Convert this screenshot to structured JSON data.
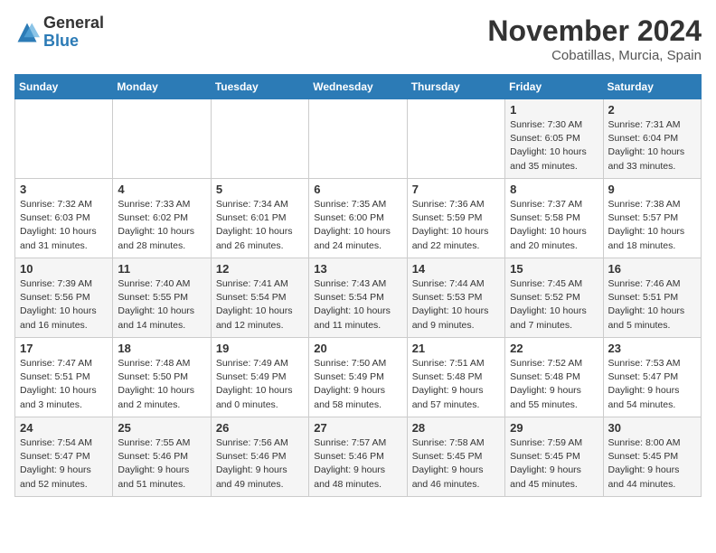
{
  "header": {
    "logo_line1": "General",
    "logo_line2": "Blue",
    "month_year": "November 2024",
    "location": "Cobatillas, Murcia, Spain"
  },
  "days_of_week": [
    "Sunday",
    "Monday",
    "Tuesday",
    "Wednesday",
    "Thursday",
    "Friday",
    "Saturday"
  ],
  "weeks": [
    [
      {
        "day": "",
        "info": ""
      },
      {
        "day": "",
        "info": ""
      },
      {
        "day": "",
        "info": ""
      },
      {
        "day": "",
        "info": ""
      },
      {
        "day": "",
        "info": ""
      },
      {
        "day": "1",
        "info": "Sunrise: 7:30 AM\nSunset: 6:05 PM\nDaylight: 10 hours and 35 minutes."
      },
      {
        "day": "2",
        "info": "Sunrise: 7:31 AM\nSunset: 6:04 PM\nDaylight: 10 hours and 33 minutes."
      }
    ],
    [
      {
        "day": "3",
        "info": "Sunrise: 7:32 AM\nSunset: 6:03 PM\nDaylight: 10 hours and 31 minutes."
      },
      {
        "day": "4",
        "info": "Sunrise: 7:33 AM\nSunset: 6:02 PM\nDaylight: 10 hours and 28 minutes."
      },
      {
        "day": "5",
        "info": "Sunrise: 7:34 AM\nSunset: 6:01 PM\nDaylight: 10 hours and 26 minutes."
      },
      {
        "day": "6",
        "info": "Sunrise: 7:35 AM\nSunset: 6:00 PM\nDaylight: 10 hours and 24 minutes."
      },
      {
        "day": "7",
        "info": "Sunrise: 7:36 AM\nSunset: 5:59 PM\nDaylight: 10 hours and 22 minutes."
      },
      {
        "day": "8",
        "info": "Sunrise: 7:37 AM\nSunset: 5:58 PM\nDaylight: 10 hours and 20 minutes."
      },
      {
        "day": "9",
        "info": "Sunrise: 7:38 AM\nSunset: 5:57 PM\nDaylight: 10 hours and 18 minutes."
      }
    ],
    [
      {
        "day": "10",
        "info": "Sunrise: 7:39 AM\nSunset: 5:56 PM\nDaylight: 10 hours and 16 minutes."
      },
      {
        "day": "11",
        "info": "Sunrise: 7:40 AM\nSunset: 5:55 PM\nDaylight: 10 hours and 14 minutes."
      },
      {
        "day": "12",
        "info": "Sunrise: 7:41 AM\nSunset: 5:54 PM\nDaylight: 10 hours and 12 minutes."
      },
      {
        "day": "13",
        "info": "Sunrise: 7:43 AM\nSunset: 5:54 PM\nDaylight: 10 hours and 11 minutes."
      },
      {
        "day": "14",
        "info": "Sunrise: 7:44 AM\nSunset: 5:53 PM\nDaylight: 10 hours and 9 minutes."
      },
      {
        "day": "15",
        "info": "Sunrise: 7:45 AM\nSunset: 5:52 PM\nDaylight: 10 hours and 7 minutes."
      },
      {
        "day": "16",
        "info": "Sunrise: 7:46 AM\nSunset: 5:51 PM\nDaylight: 10 hours and 5 minutes."
      }
    ],
    [
      {
        "day": "17",
        "info": "Sunrise: 7:47 AM\nSunset: 5:51 PM\nDaylight: 10 hours and 3 minutes."
      },
      {
        "day": "18",
        "info": "Sunrise: 7:48 AM\nSunset: 5:50 PM\nDaylight: 10 hours and 2 minutes."
      },
      {
        "day": "19",
        "info": "Sunrise: 7:49 AM\nSunset: 5:49 PM\nDaylight: 10 hours and 0 minutes."
      },
      {
        "day": "20",
        "info": "Sunrise: 7:50 AM\nSunset: 5:49 PM\nDaylight: 9 hours and 58 minutes."
      },
      {
        "day": "21",
        "info": "Sunrise: 7:51 AM\nSunset: 5:48 PM\nDaylight: 9 hours and 57 minutes."
      },
      {
        "day": "22",
        "info": "Sunrise: 7:52 AM\nSunset: 5:48 PM\nDaylight: 9 hours and 55 minutes."
      },
      {
        "day": "23",
        "info": "Sunrise: 7:53 AM\nSunset: 5:47 PM\nDaylight: 9 hours and 54 minutes."
      }
    ],
    [
      {
        "day": "24",
        "info": "Sunrise: 7:54 AM\nSunset: 5:47 PM\nDaylight: 9 hours and 52 minutes."
      },
      {
        "day": "25",
        "info": "Sunrise: 7:55 AM\nSunset: 5:46 PM\nDaylight: 9 hours and 51 minutes."
      },
      {
        "day": "26",
        "info": "Sunrise: 7:56 AM\nSunset: 5:46 PM\nDaylight: 9 hours and 49 minutes."
      },
      {
        "day": "27",
        "info": "Sunrise: 7:57 AM\nSunset: 5:46 PM\nDaylight: 9 hours and 48 minutes."
      },
      {
        "day": "28",
        "info": "Sunrise: 7:58 AM\nSunset: 5:45 PM\nDaylight: 9 hours and 46 minutes."
      },
      {
        "day": "29",
        "info": "Sunrise: 7:59 AM\nSunset: 5:45 PM\nDaylight: 9 hours and 45 minutes."
      },
      {
        "day": "30",
        "info": "Sunrise: 8:00 AM\nSunset: 5:45 PM\nDaylight: 9 hours and 44 minutes."
      }
    ]
  ]
}
